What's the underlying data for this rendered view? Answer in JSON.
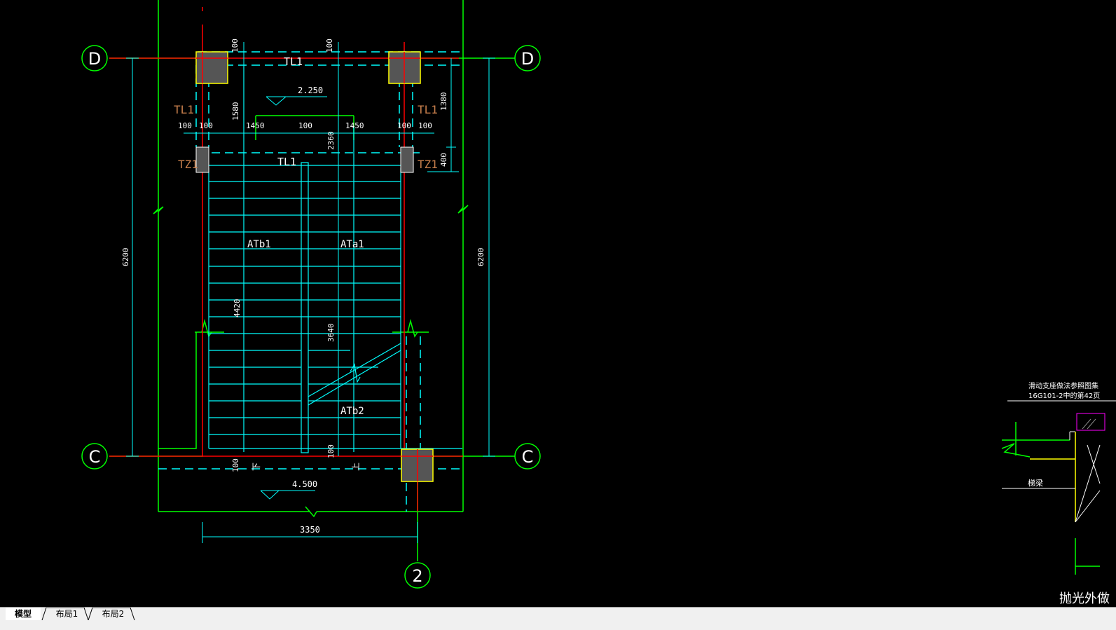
{
  "drawing": {
    "grid_labels": {
      "D_left": "D",
      "D_right": "D",
      "C_left": "C",
      "C_right": "C",
      "axis_2": "2"
    },
    "beam_tl1_top": "TL1",
    "beam_tl1_left": "TL1",
    "beam_tl1_right": "TL1",
    "beam_tl1_mid": "TL1",
    "column_tz1_left": "TZ1",
    "column_tz1_right": "TZ1",
    "slab_atb1": "ATb1",
    "slab_ata1": "ATa1",
    "slab_atb2": "ATb2",
    "elev_top": "2.250",
    "elev_bottom": "4.500",
    "dims": {
      "d100_top_a": "100",
      "d100_top_b": "100",
      "d1580": "1580",
      "d1380": "1380",
      "d400": "400",
      "d100_l1": "100",
      "d100_l2": "100",
      "d1450_a": "1450",
      "d100_mid": "100",
      "d1450_b": "1450",
      "d100_r1": "100",
      "d100_r2": "100",
      "d2360": "2360",
      "d6200_left": "6200",
      "d6200_right": "6200",
      "d4420": "4420",
      "d3640": "3640",
      "d100_bot_a": "100",
      "d100_bot_b": "100",
      "d3350": "3350"
    },
    "down_mark": "下",
    "up_mark": "上",
    "detail_note_line1": "滑动支座做法参照图集",
    "detail_note_line2": "16G101-2中的第42页",
    "detail_label": "梯梁",
    "detail_caption": "抛光外做"
  },
  "tabs": [
    {
      "label": "模型",
      "active": true
    },
    {
      "label": "布局1",
      "active": false
    },
    {
      "label": "布局2",
      "active": false
    }
  ],
  "colors": {
    "cyan": "#00ffff",
    "green": "#00ff00",
    "red": "#ff0000",
    "yellow": "#ffff00",
    "orange": "#c87f4c",
    "white": "#ffffff",
    "magenta": "#ff00ff",
    "background": "#000000"
  }
}
